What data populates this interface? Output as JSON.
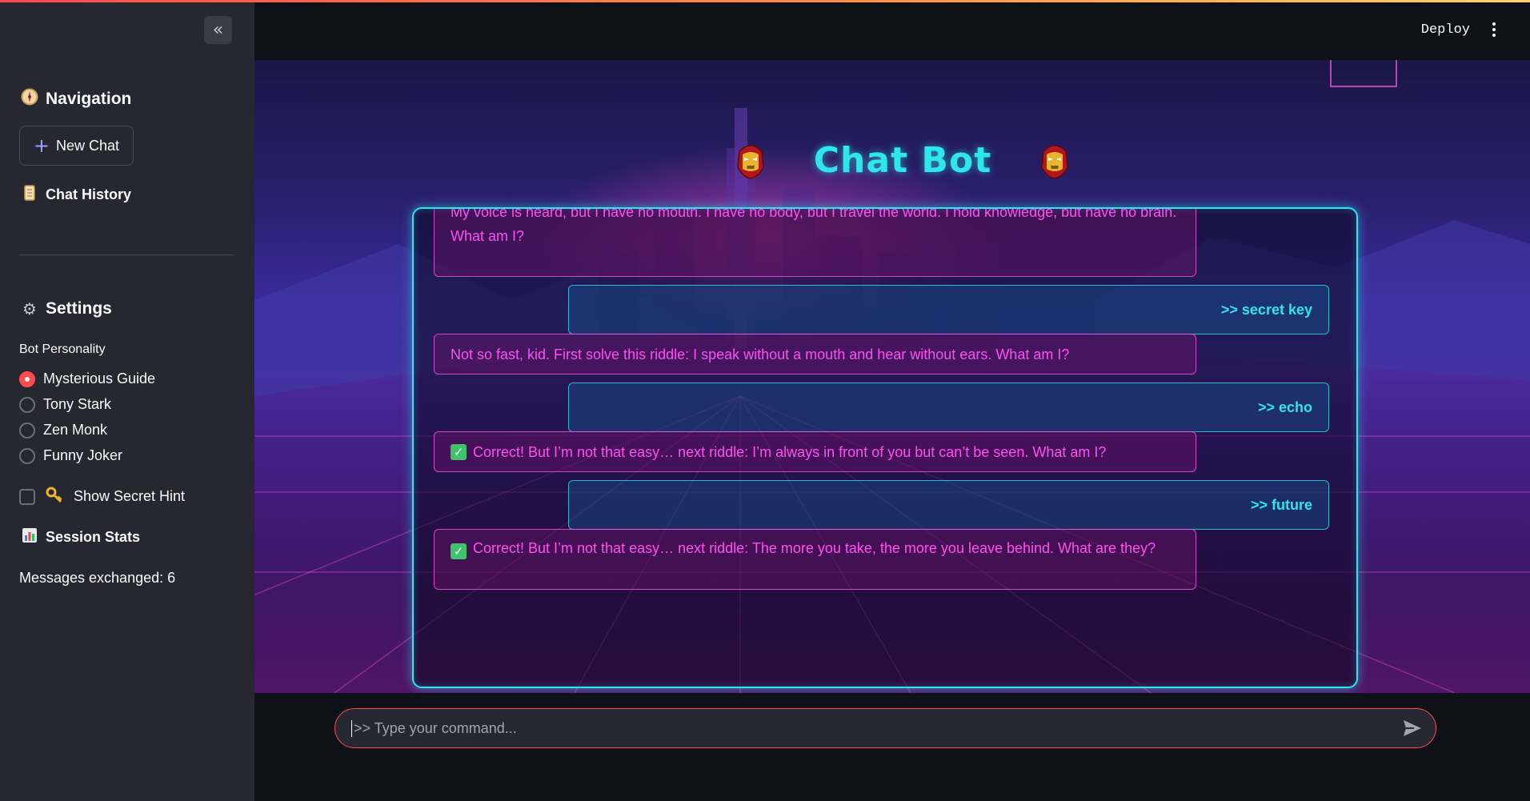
{
  "sidebar": {
    "navigation_title": "Navigation",
    "new_chat_label": "New Chat",
    "chat_history_title": "Chat History",
    "settings_title": "Settings",
    "personality_label": "Bot Personality",
    "personalities": [
      "Mysterious Guide",
      "Tony Stark",
      "Zen Monk",
      "Funny Joker"
    ],
    "selected_personality": "Mysterious Guide",
    "secret_hint_label": "Show Secret Hint",
    "session_stats_title": "Session Stats",
    "messages_exchanged": "Messages exchanged: 6"
  },
  "header": {
    "deploy_label": "Deploy"
  },
  "main": {
    "title": "Chat Bot",
    "messages": [
      {
        "role": "bot",
        "text": "My voice is heard, but I have no mouth. I have no body, but I travel the world. I hold knowledge, but have no brain. What am I?"
      },
      {
        "role": "user",
        "text": ">> secret key"
      },
      {
        "role": "bot",
        "text": "Not so fast, kid. First solve this riddle: I speak without a mouth and hear without ears. What am I?"
      },
      {
        "role": "user",
        "text": ">> echo"
      },
      {
        "role": "bot",
        "text": "Correct! But I’m not that easy… next riddle: I’m always in front of you but can’t be seen. What am I?"
      },
      {
        "role": "user",
        "text": ">> future"
      },
      {
        "role": "bot",
        "text": "Correct! But I’m not that easy… next riddle: The more you take, the more you leave behind. What are they?"
      }
    ]
  },
  "input": {
    "placeholder": ">> Type your command..."
  },
  "colors": {
    "accent_cyan": "#2ee6ee",
    "accent_magenta": "#ff4ff2",
    "accent_red": "#ff4b4b",
    "sidebar_bg": "#262730",
    "app_bg": "#0e1117"
  },
  "icons": {
    "navigation": "compass-icon",
    "chat_history": "scroll-icon",
    "settings": "gear-icon",
    "secret_hint": "key-icon",
    "session_stats": "bar-chart-icon",
    "title": "iron-man-helmet-icon",
    "send": "send-icon"
  }
}
